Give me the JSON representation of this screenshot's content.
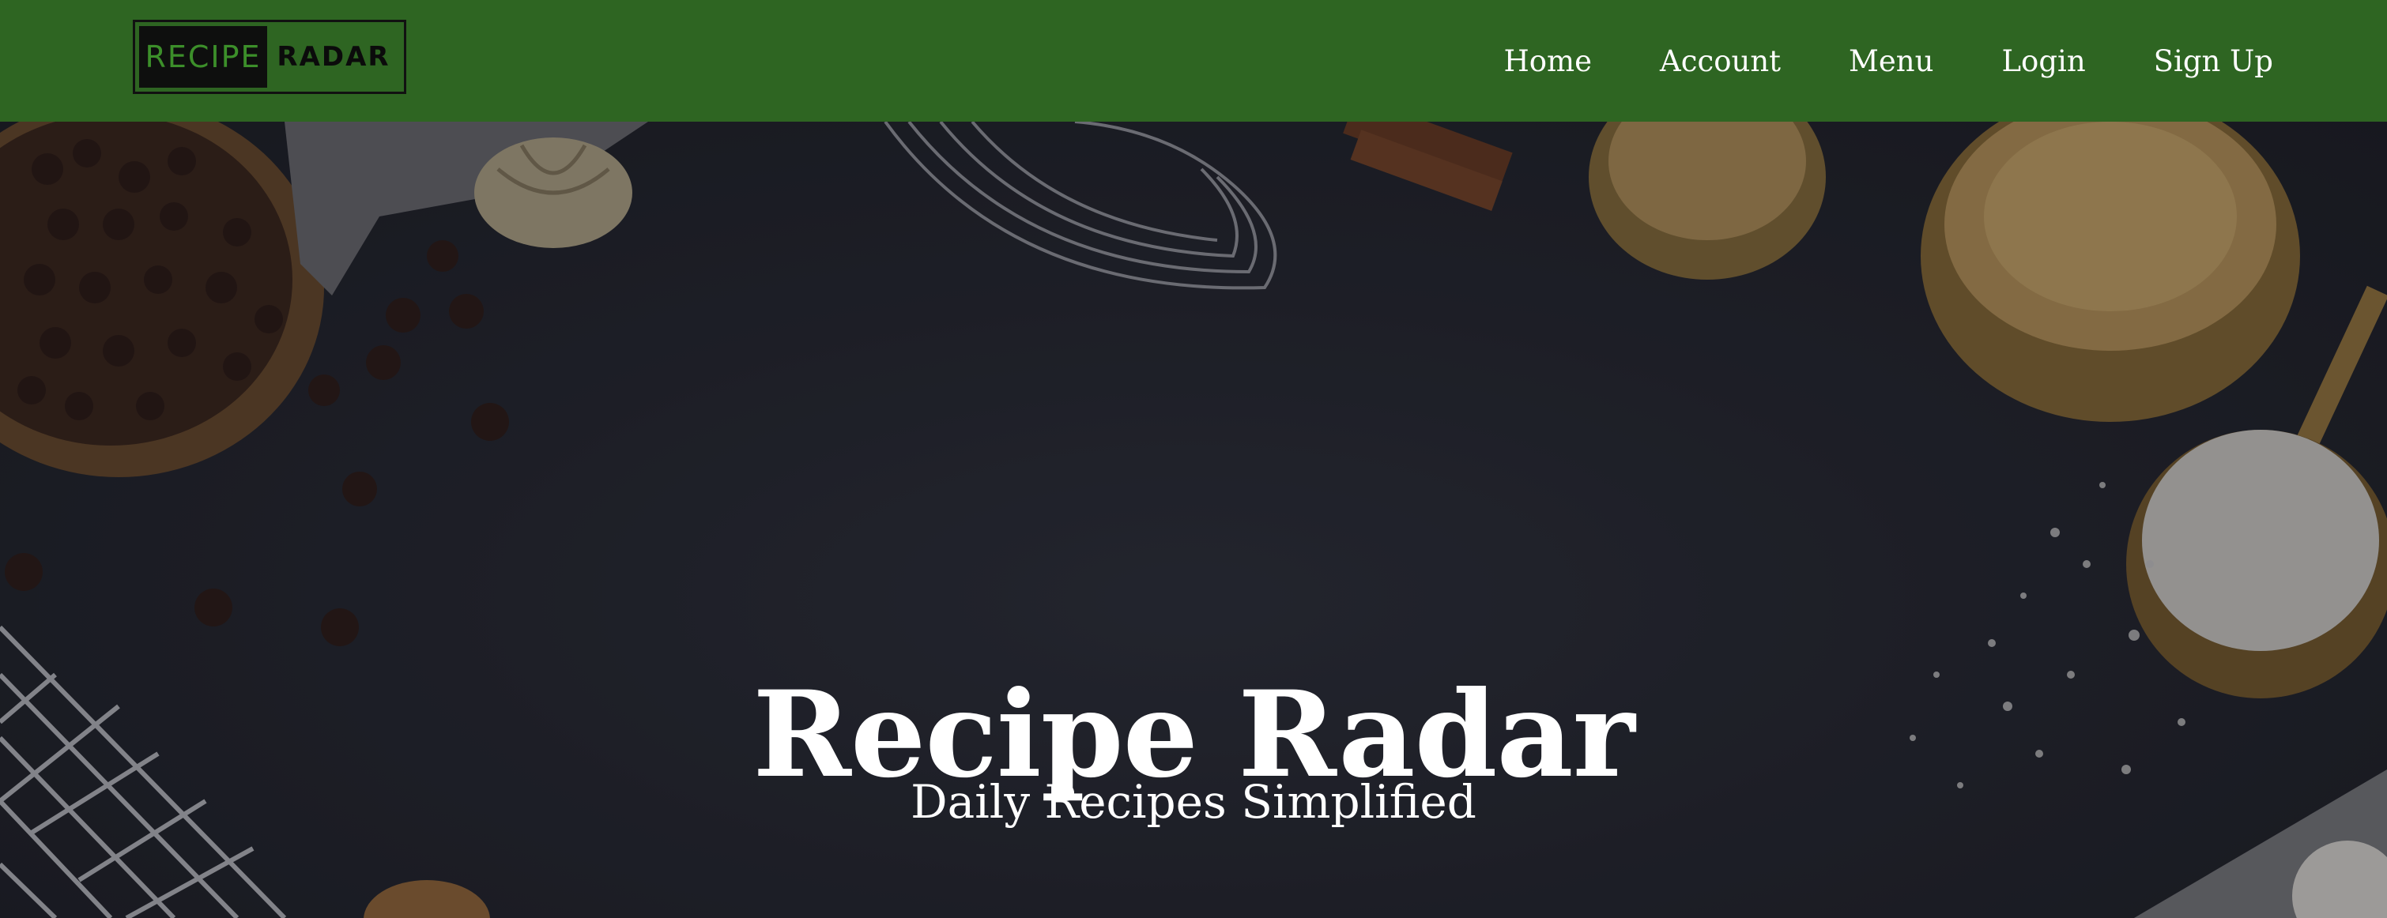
{
  "header": {
    "logo": {
      "left_text": "RECIPE",
      "right_text": "RADAR"
    },
    "nav": [
      {
        "label": "Home"
      },
      {
        "label": "Account"
      },
      {
        "label": "Menu"
      },
      {
        "label": "Login"
      },
      {
        "label": "Sign Up"
      }
    ]
  },
  "hero": {
    "title": "Recipe Radar",
    "subtitle": "Daily Recipes Simplified"
  },
  "colors": {
    "header_bg": "#2e6522",
    "logo_accent": "#3c8f2a",
    "hero_bg": "#1b1d24",
    "text": "#ffffff"
  }
}
